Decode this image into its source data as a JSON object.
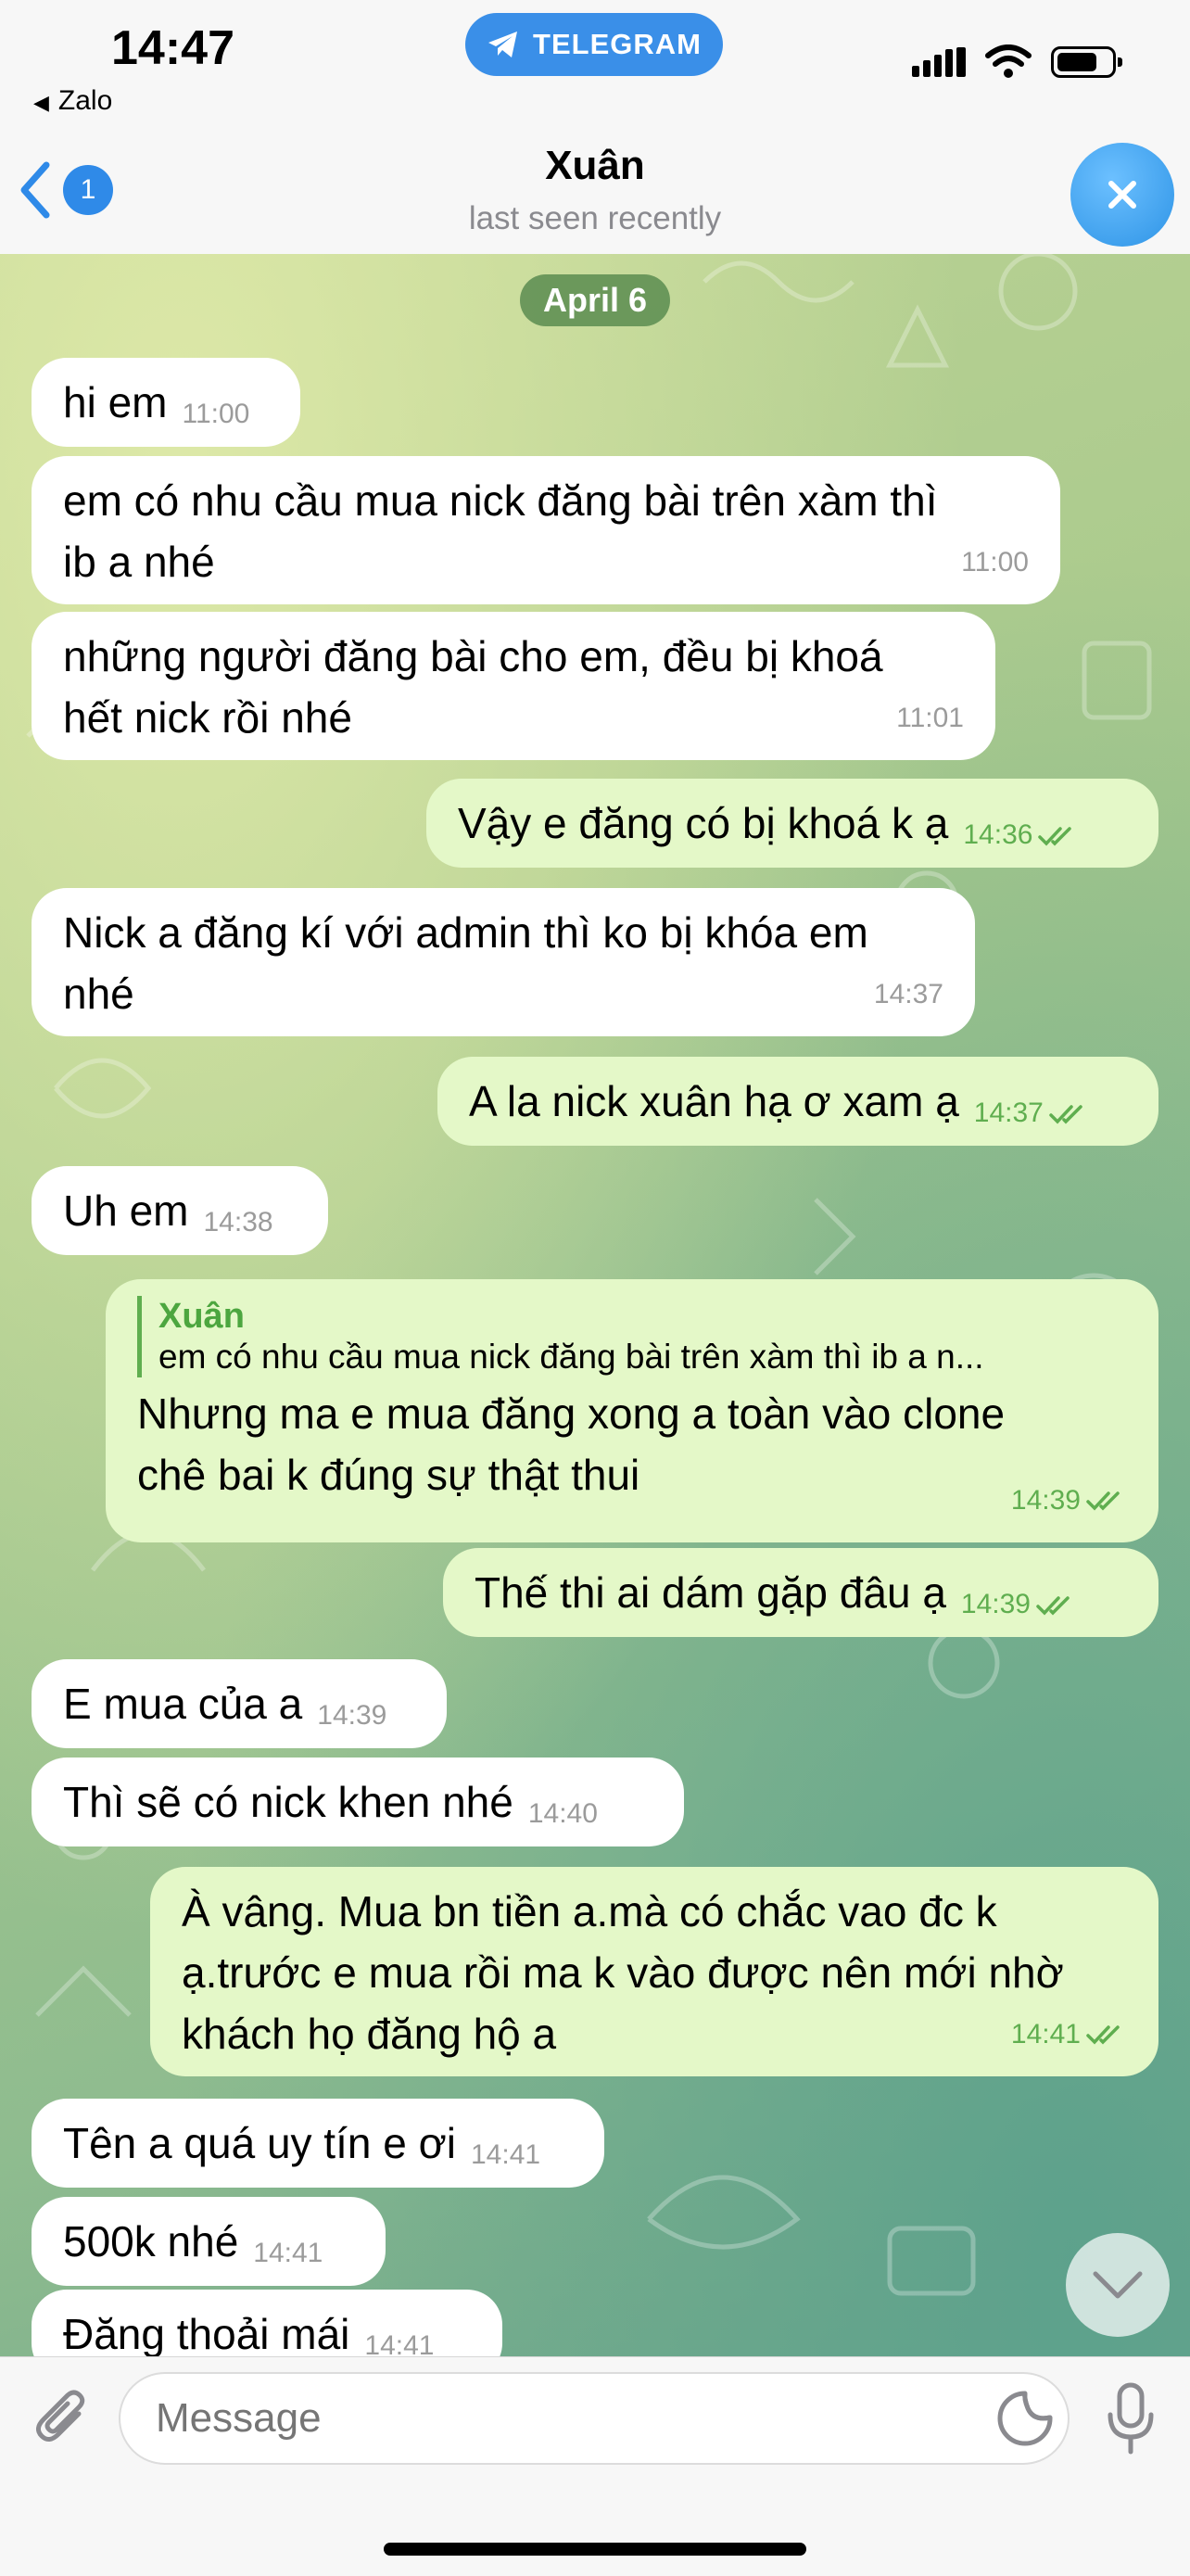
{
  "status_bar": {
    "time": "14:47",
    "back_app": "Zalo",
    "pill_label": "TELEGRAM",
    "pill_color": "#3a8fe8"
  },
  "header": {
    "back_badge": "1",
    "title": "Xuân",
    "subtitle": "last seen recently",
    "avatar_icon": "close-x-icon"
  },
  "chat": {
    "date": "April 6",
    "messages": [
      {
        "dir": "in",
        "text": "hi em",
        "time": "11:00"
      },
      {
        "dir": "in",
        "lines": [
          "em có nhu cầu mua nick đăng bài trên xàm thì",
          "ib a nhé"
        ],
        "time": "11:00"
      },
      {
        "dir": "in",
        "lines": [
          "những người đăng bài cho em, đều bị khoá",
          "hết nick rồi nhé"
        ],
        "time": "11:01"
      },
      {
        "dir": "out",
        "text": "Vậy e đăng có bị khoá k ạ",
        "time": "14:36",
        "read": true
      },
      {
        "dir": "in",
        "lines": [
          "Nick a đăng kí với admin thì ko bị khóa em",
          "nhé"
        ],
        "time": "14:37"
      },
      {
        "dir": "out",
        "text": "A la nick xuân hạ ơ xam ạ",
        "time": "14:37",
        "read": true
      },
      {
        "dir": "in",
        "text": "Uh em",
        "time": "14:38"
      },
      {
        "dir": "out",
        "reply_to": {
          "name": "Xuân",
          "text": "em có nhu cầu mua nick đăng bài trên xàm thì ib a n..."
        },
        "lines": [
          "Nhưng ma e mua đăng xong a toàn vào clone",
          "chê bai k đúng sự thật thui"
        ],
        "time": "14:39",
        "read": true
      },
      {
        "dir": "out",
        "text": "Thế thi ai dám gặp đâu ạ",
        "time": "14:39",
        "read": true
      },
      {
        "dir": "in",
        "text": "E mua của a",
        "time": "14:39"
      },
      {
        "dir": "in",
        "text": "Thì sẽ có nick khen nhé",
        "time": "14:40"
      },
      {
        "dir": "out",
        "lines": [
          "À vâng. Mua bn tiền a.mà có chắc vao đc k",
          "ạ.trước e mua rồi ma k vào được nên mới nhờ",
          "khách họ đăng hộ a"
        ],
        "time": "14:41",
        "read": true
      },
      {
        "dir": "in",
        "text": "Tên a quá uy tín e ơi",
        "time": "14:41"
      },
      {
        "dir": "in",
        "text": "500k nhé",
        "time": "14:41"
      },
      {
        "dir": "in",
        "text": "Đăng thoải mái",
        "time": "14:41"
      }
    ]
  },
  "input": {
    "placeholder": "Message"
  },
  "colors": {
    "incoming_bubble": "#ffffff",
    "outgoing_bubble": "#e4f8c8",
    "outgoing_meta": "#5fae4f",
    "accent": "#2f8ae8"
  }
}
